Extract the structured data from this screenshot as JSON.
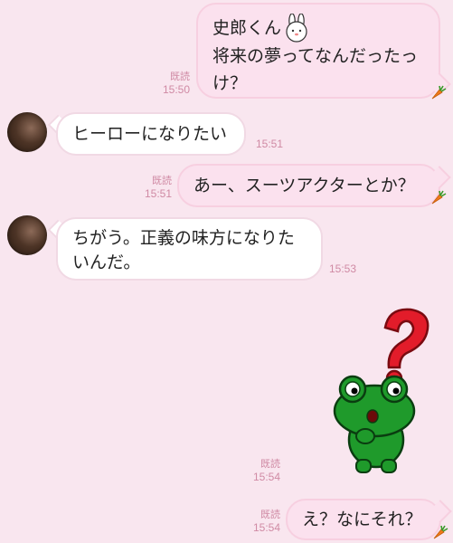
{
  "messages": [
    {
      "id": 1,
      "side": "out",
      "line1": "史郎くん",
      "line2": "将来の夢ってなんだったっけ？",
      "read": "既読",
      "time": "15:50"
    },
    {
      "id": 2,
      "side": "in",
      "text": "ヒーローになりたい",
      "time": "15:51"
    },
    {
      "id": 3,
      "side": "out",
      "text": "あー、スーツアクターとか？",
      "read": "既読",
      "time": "15:51"
    },
    {
      "id": 4,
      "side": "in",
      "line1": "ちがう。正義の味方になりた",
      "line2": "いんだ。",
      "time": "15:53"
    },
    {
      "id": 5,
      "side": "out",
      "type": "sticker",
      "sticker": "frog-question-sticker",
      "read": "既読",
      "time": "15:54"
    },
    {
      "id": 6,
      "side": "out",
      "text": "え？なにそれ？",
      "read": "既読",
      "time": "15:54"
    }
  ],
  "icons": {
    "emoji": "bunny-face-emoji",
    "bubble_decoration": "carrot-icon",
    "avatar": "contact-avatar"
  },
  "colors": {
    "background": "#f9e6ef",
    "outgoing_bubble": "#fbe1ee",
    "incoming_bubble": "#ffffff",
    "meta_text": "#d08aa4",
    "sticker_red": "#e21c2a",
    "sticker_green": "#1f9a2b"
  }
}
